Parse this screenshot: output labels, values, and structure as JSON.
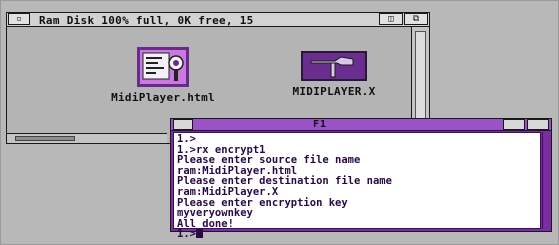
{
  "drawer": {
    "title": "Ram Disk  100% full, 0K free, 15",
    "close_glyph": "▫",
    "zoom_glyph": "◫",
    "depth_glyph": "⧉",
    "scroll_up_glyph": "▲",
    "icons": [
      {
        "label": "MidiPlayer.html",
        "icon": "html-document-icon"
      },
      {
        "label": "MIDIPLAYER.X",
        "icon": "hammer-tool-icon"
      }
    ]
  },
  "shell": {
    "title": "F1",
    "lines": [
      "1.>",
      "1.>rx encrypt1",
      "Please enter source file name",
      "ram:MidiPlayer.html",
      "Please enter destination file name",
      "ram:MidiPlayer.X",
      "Please enter encryption key",
      "myveryownkey",
      "All done!"
    ],
    "prompt": "1.>"
  },
  "colors": {
    "desktop": "#b8b8b8",
    "shell_frame": "#7a2ea4",
    "shell_text": "#2a0a44"
  }
}
